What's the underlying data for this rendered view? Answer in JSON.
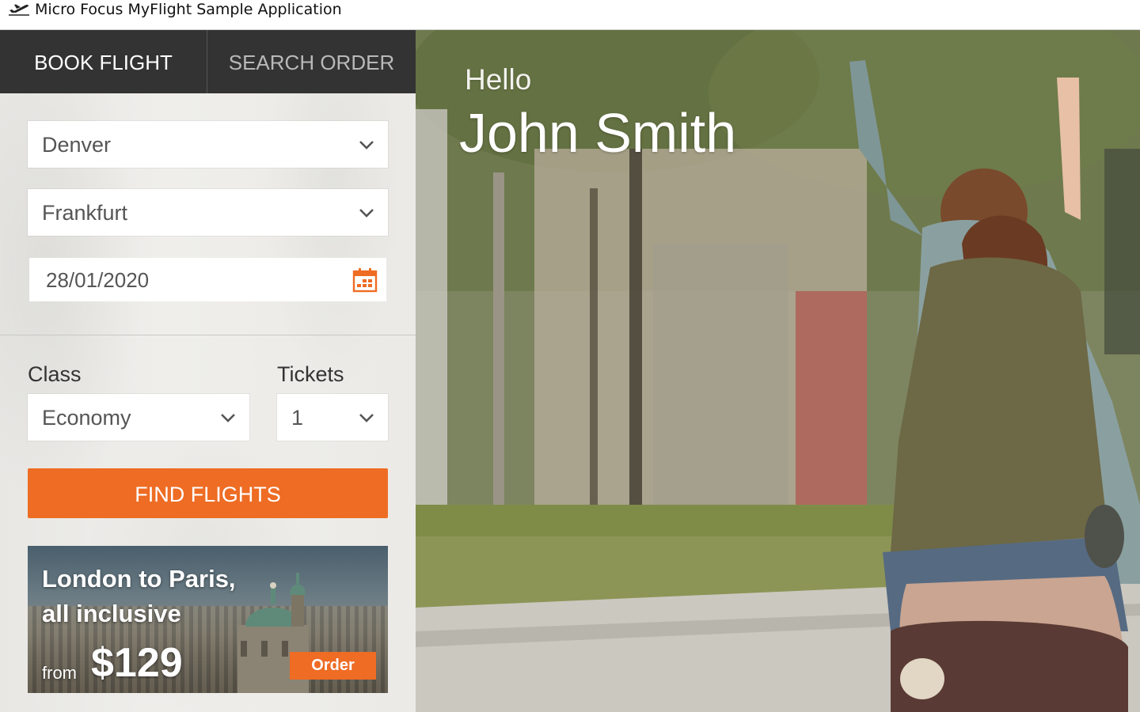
{
  "window": {
    "title": "Micro Focus MyFlight Sample Application",
    "icon": "airplane-takeoff-icon"
  },
  "tabs": [
    {
      "label": "BOOK FLIGHT",
      "active": true
    },
    {
      "label": "SEARCH ORDER",
      "active": false
    }
  ],
  "booking": {
    "from_city": "Denver",
    "to_city": "Frankfurt",
    "date": "28/01/2020",
    "class_label": "Class",
    "class_value": "Economy",
    "tickets_label": "Tickets",
    "tickets_value": "1",
    "find_button": "FIND FLIGHTS"
  },
  "promo": {
    "headline_line1": "London to Paris,",
    "headline_line2": "all inclusive",
    "from_label": "from",
    "price": "$129",
    "order_button": "Order"
  },
  "greeting": {
    "hello": "Hello",
    "name": "John Smith"
  },
  "colors": {
    "accent": "#ee6c24",
    "tab_bar": "#333333"
  }
}
